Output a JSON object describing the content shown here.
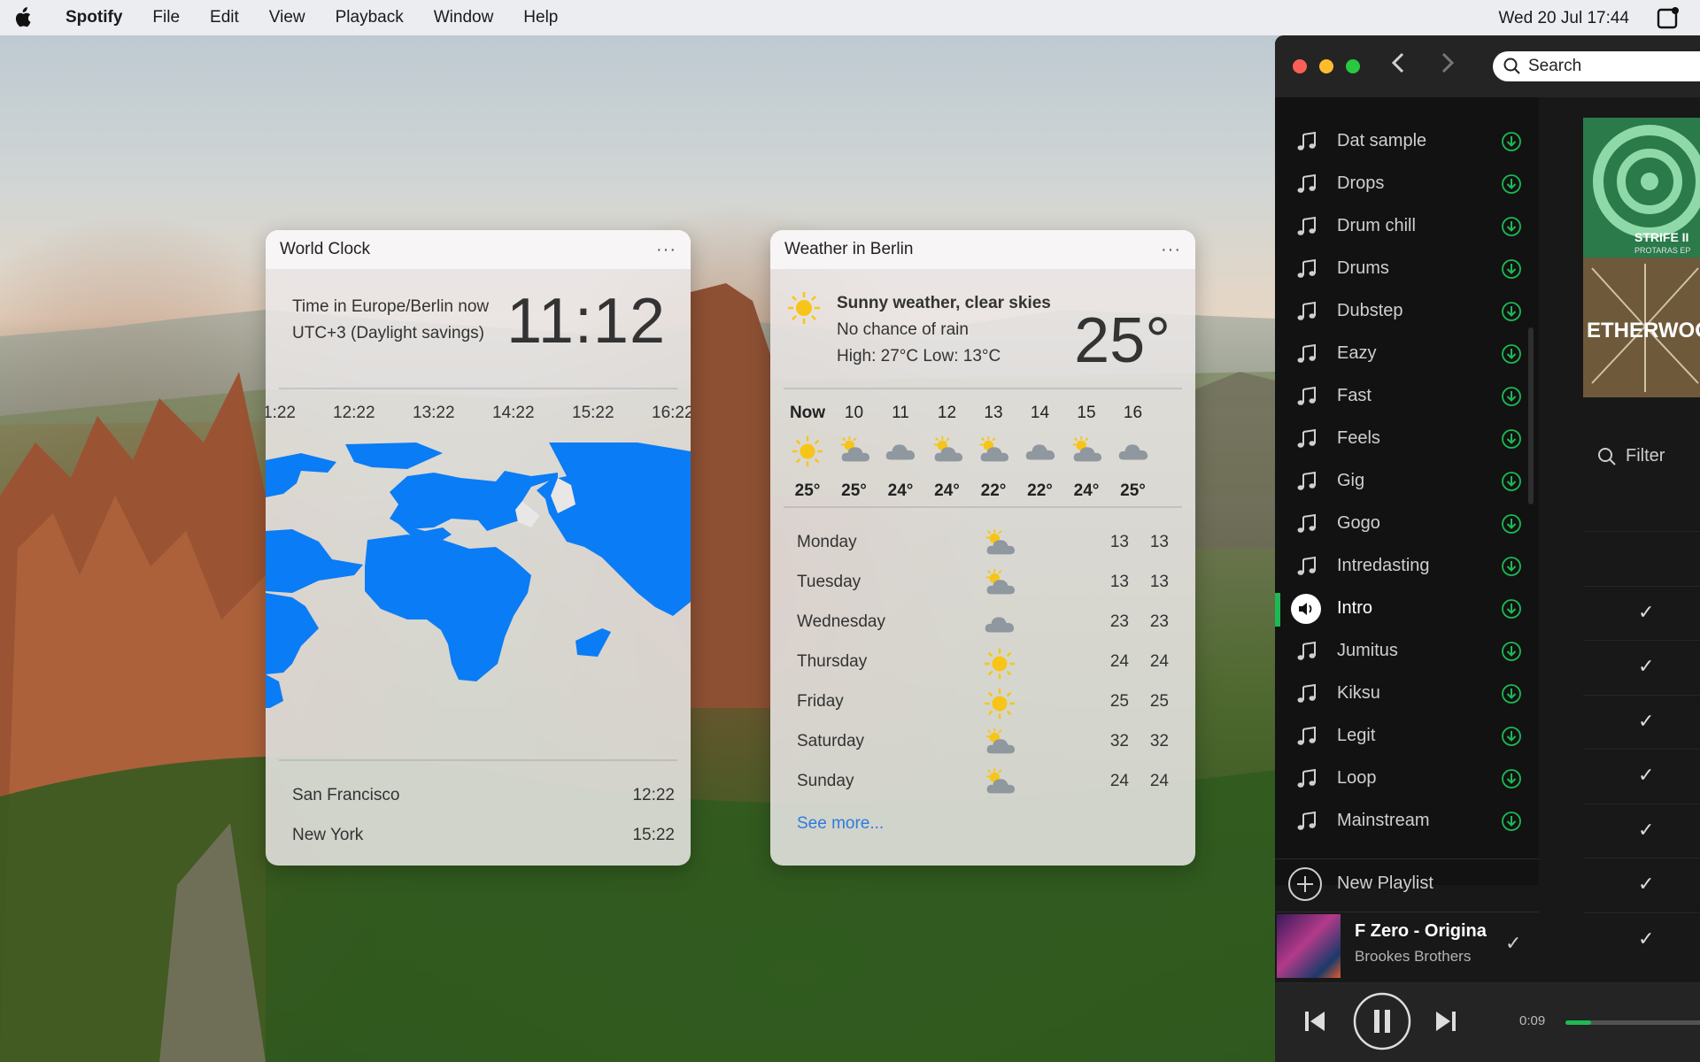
{
  "menubar": {
    "app_name": "Spotify",
    "menus": [
      "File",
      "Edit",
      "View",
      "Playback",
      "Window",
      "Help"
    ],
    "datetime": "Wed 20 Jul 17:44"
  },
  "world_clock": {
    "title": "World Clock",
    "more": "···",
    "tz_line1": "Time in Europe/Berlin now",
    "tz_line2": "UTC+3 (Daylight savings)",
    "time": "11:12",
    "hours": [
      "1:22",
      "12:22",
      "13:22",
      "14:22",
      "15:22",
      "16:22"
    ],
    "cities": [
      {
        "name": "San Francisco",
        "time": "12:22"
      },
      {
        "name": "New York",
        "time": "15:22"
      }
    ]
  },
  "weather": {
    "title": "Weather in Berlin",
    "more": "···",
    "summary": "Sunny weather, clear skies",
    "rain": "No chance of rain",
    "highlow": "High: 27°C Low: 13°C",
    "temp": "25°",
    "hourly": [
      {
        "label": "Now",
        "icon": "sun-icon",
        "temp": "25°"
      },
      {
        "label": "10",
        "icon": "partly-cloudy-icon",
        "temp": "25°"
      },
      {
        "label": "11",
        "icon": "cloud-icon",
        "temp": "24°"
      },
      {
        "label": "12",
        "icon": "partly-cloudy-icon",
        "temp": "24°"
      },
      {
        "label": "13",
        "icon": "partly-cloudy-icon",
        "temp": "22°"
      },
      {
        "label": "14",
        "icon": "cloud-icon",
        "temp": "22°"
      },
      {
        "label": "15",
        "icon": "partly-cloudy-icon",
        "temp": "24°"
      },
      {
        "label": "16",
        "icon": "cloud-icon",
        "temp": "25°"
      }
    ],
    "daily": [
      {
        "day": "Monday",
        "icon": "partly-cloudy-icon",
        "lo": "13",
        "hi": "13"
      },
      {
        "day": "Tuesday",
        "icon": "partly-cloudy-icon",
        "lo": "13",
        "hi": "13"
      },
      {
        "day": "Wednesday",
        "icon": "cloud-icon",
        "lo": "23",
        "hi": "23"
      },
      {
        "day": "Thursday",
        "icon": "sun-icon",
        "lo": "24",
        "hi": "24"
      },
      {
        "day": "Friday",
        "icon": "sun-icon",
        "lo": "25",
        "hi": "25"
      },
      {
        "day": "Saturday",
        "icon": "partly-cloudy-icon",
        "lo": "32",
        "hi": "32"
      },
      {
        "day": "Sunday",
        "icon": "partly-cloudy-icon",
        "lo": "24",
        "hi": "24"
      }
    ],
    "see_more": "See more..."
  },
  "spotify": {
    "search_placeholder": "Search",
    "playlists": [
      {
        "name": "Dat sample"
      },
      {
        "name": "Drops"
      },
      {
        "name": "Drum chill"
      },
      {
        "name": "Drums"
      },
      {
        "name": "Dubstep"
      },
      {
        "name": "Eazy"
      },
      {
        "name": "Fast"
      },
      {
        "name": "Feels"
      },
      {
        "name": "Gig"
      },
      {
        "name": "Gogo"
      },
      {
        "name": "Intredasting"
      },
      {
        "name": "Intro",
        "active": true
      },
      {
        "name": "Jumitus"
      },
      {
        "name": "Kiksu"
      },
      {
        "name": "Legit"
      },
      {
        "name": "Loop"
      },
      {
        "name": "Mainstream"
      }
    ],
    "new_playlist": "New Playlist",
    "now_playing": {
      "title": "F Zero - Origina",
      "artist": "Brookes Brothers"
    },
    "filter_label": "Filter",
    "album_text_1": "STRIFE II",
    "album_text_2": "PROTARAS EP",
    "album_text_3": "ETHERWOO",
    "position": "0:09",
    "progress": 0.18,
    "accent": "#1db954"
  }
}
